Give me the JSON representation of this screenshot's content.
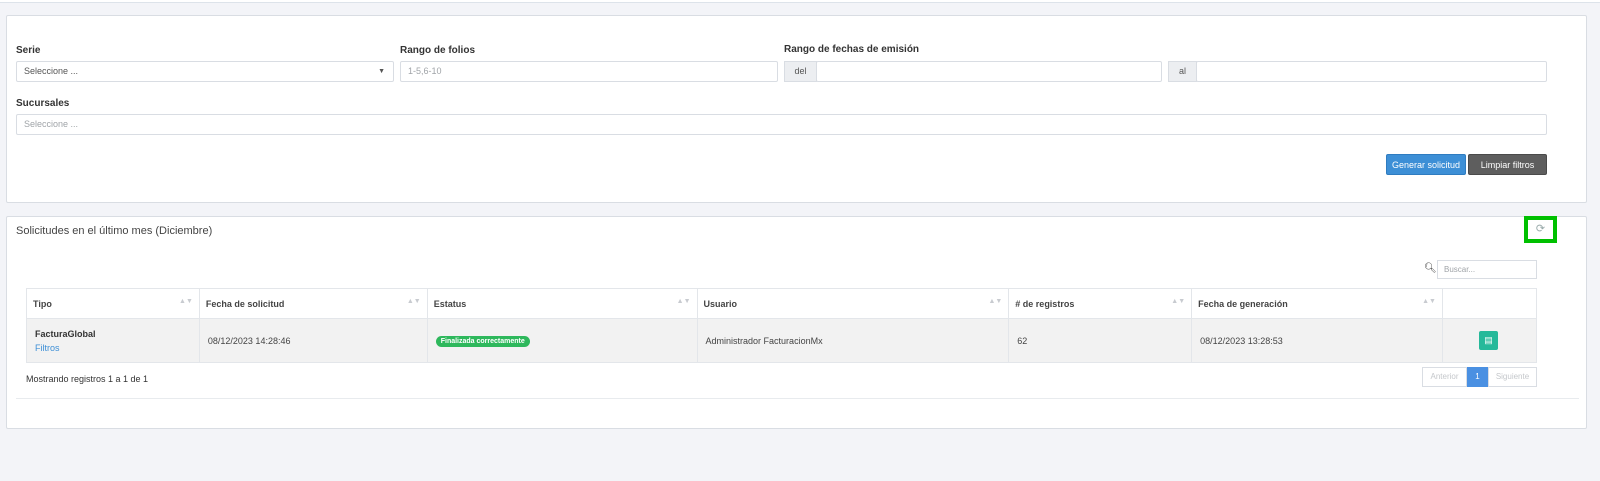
{
  "filters": {
    "serie_label": "Serie",
    "serie_value": "Seleccione ...",
    "folios_label": "Rango de folios",
    "folios_placeholder": "1-5,6-10",
    "fechas_label": "Rango de fechas de emisión",
    "del_label": "del",
    "al_label": "al",
    "sucursales_label": "Sucursales",
    "sucursales_placeholder": "Seleccione ...",
    "generate_button": "Generar solicitud",
    "clear_button": "Limpiar filtros"
  },
  "list": {
    "title": "Solicitudes en el último mes (Diciembre)",
    "search_placeholder": "Buscar...",
    "columns": [
      "Tipo",
      "Fecha de solicitud",
      "Estatus",
      "Usuario",
      "# de registros",
      "Fecha de generación"
    ],
    "rows": [
      {
        "tipo": "FacturaGlobal",
        "tipo_link": "Filtros",
        "fecha_solicitud": "08/12/2023 14:28:46",
        "estatus": "Finalizada correctamente",
        "usuario": "Administrador FacturacionMx",
        "registros": "62",
        "fecha_generacion": "08/12/2023 13:28:53"
      }
    ],
    "info": "Mostrando registros 1 a 1 de 1",
    "pager": {
      "prev": "Anterior",
      "page": "1",
      "next": "Siguiente"
    }
  },
  "colors": {
    "accent": "#3d8fd6",
    "success": "#2eb85c",
    "download": "#26b99a",
    "highlight": "#00c000"
  },
  "icons": {
    "refresh": "refresh-icon",
    "search": "search-icon",
    "download": "file-download-icon",
    "caret": "caret-down-icon"
  }
}
